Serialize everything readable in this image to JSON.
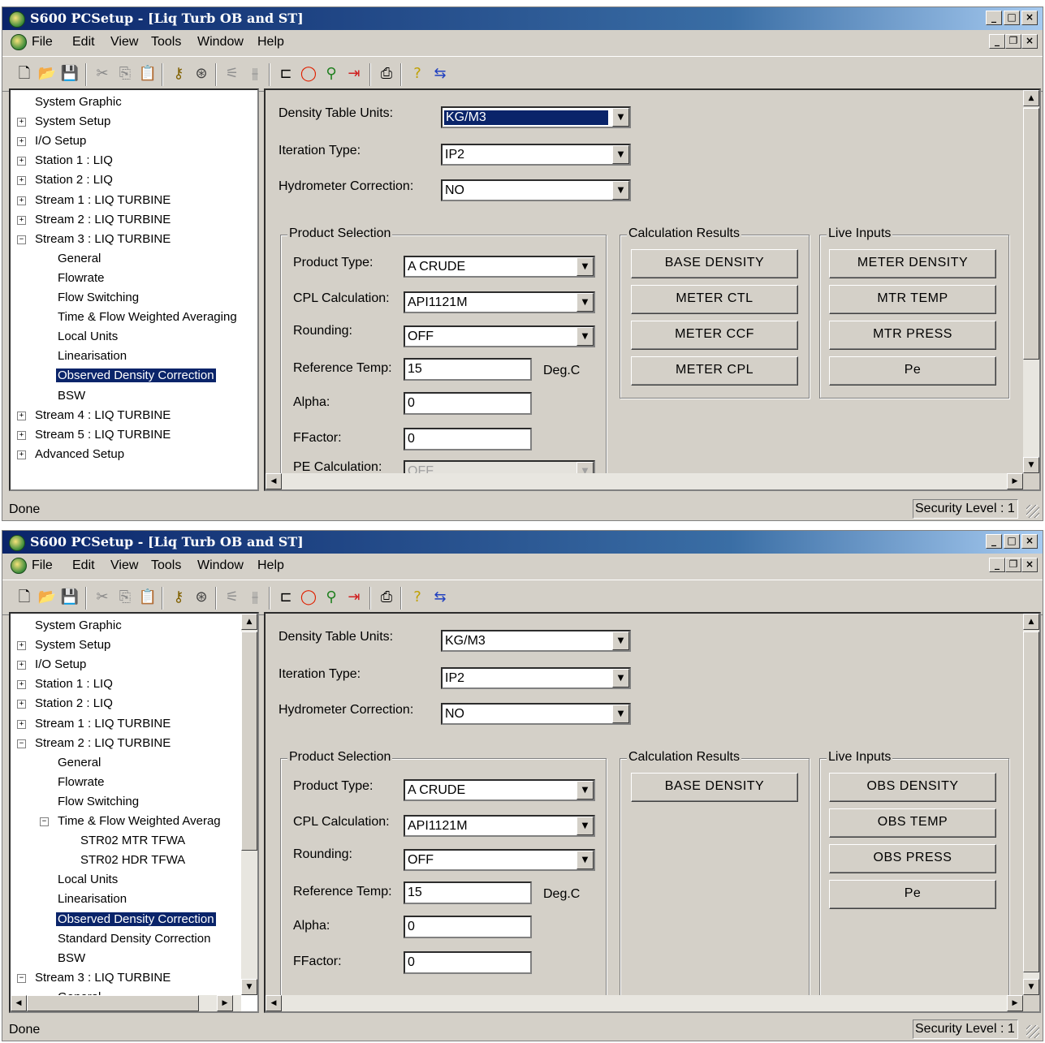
{
  "windows": [
    {
      "title": "S600 PCSetup - [Liq Turb OB and ST]",
      "menu": [
        "File",
        "Edit",
        "View",
        "Tools",
        "Window",
        "Help"
      ],
      "tree": [
        {
          "label": "System Graphic",
          "level": 0,
          "expander": "none"
        },
        {
          "label": "System Setup",
          "level": 0,
          "expander": "plus"
        },
        {
          "label": "I/O Setup",
          "level": 0,
          "expander": "plus"
        },
        {
          "label": "Station 1 : LIQ",
          "level": 0,
          "expander": "plus"
        },
        {
          "label": "Station 2 : LIQ",
          "level": 0,
          "expander": "plus"
        },
        {
          "label": "Stream 1 : LIQ TURBINE",
          "level": 0,
          "expander": "plus"
        },
        {
          "label": "Stream 2 : LIQ TURBINE",
          "level": 0,
          "expander": "plus"
        },
        {
          "label": "Stream 3 : LIQ TURBINE",
          "level": 0,
          "expander": "minus"
        },
        {
          "label": "General",
          "level": 1,
          "expander": "none"
        },
        {
          "label": "Flowrate",
          "level": 1,
          "expander": "none"
        },
        {
          "label": "Flow Switching",
          "level": 1,
          "expander": "none"
        },
        {
          "label": "Time & Flow Weighted Averaging",
          "level": 1,
          "expander": "none"
        },
        {
          "label": "Local Units",
          "level": 1,
          "expander": "none"
        },
        {
          "label": "Linearisation",
          "level": 1,
          "expander": "none"
        },
        {
          "label": "Observed Density Correction",
          "level": 1,
          "expander": "none",
          "selected": true
        },
        {
          "label": "BSW",
          "level": 1,
          "expander": "none"
        },
        {
          "label": "Stream 4 : LIQ TURBINE",
          "level": 0,
          "expander": "plus"
        },
        {
          "label": "Stream 5 : LIQ TURBINE",
          "level": 0,
          "expander": "plus"
        },
        {
          "label": "Advanced Setup",
          "level": 0,
          "expander": "plus"
        }
      ],
      "form": {
        "density_table_units_label": "Density Table Units:",
        "density_table_units_value": "KG/M3",
        "iteration_type_label": "Iteration Type:",
        "iteration_type_value": "IP2",
        "hydrometer_label": "Hydrometer Correction:",
        "hydrometer_value": "NO",
        "product_selection_label": "Product Selection",
        "product_type_label": "Product Type:",
        "product_type_value": "A CRUDE",
        "cpl_label": "CPL Calculation:",
        "cpl_value": "API1121M",
        "rounding_label": "Rounding:",
        "rounding_value": "OFF",
        "ref_temp_label": "Reference Temp:",
        "ref_temp_value": "15",
        "ref_temp_unit": "Deg.C",
        "alpha_label": "Alpha:",
        "alpha_value": "0",
        "ffactor_label": "FFactor:",
        "ffactor_value": "0",
        "pe_label": "PE Calculation:",
        "pe_value": "OFF",
        "calc_results_label": "Calculation Results",
        "calc_buttons": [
          "BASE DENSITY",
          "METER CTL",
          "METER CCF",
          "METER CPL"
        ],
        "live_inputs_label": "Live Inputs",
        "live_buttons": [
          "METER DENSITY",
          "MTR TEMP",
          "MTR PRESS",
          "Pe"
        ]
      },
      "status": {
        "left": "Done",
        "right": "Security Level : 1"
      }
    },
    {
      "title": "S600 PCSetup - [Liq Turb OB and ST]",
      "menu": [
        "File",
        "Edit",
        "View",
        "Tools",
        "Window",
        "Help"
      ],
      "tree": [
        {
          "label": "System Graphic",
          "level": 0,
          "expander": "none"
        },
        {
          "label": "System Setup",
          "level": 0,
          "expander": "plus"
        },
        {
          "label": "I/O Setup",
          "level": 0,
          "expander": "plus"
        },
        {
          "label": "Station 1 : LIQ",
          "level": 0,
          "expander": "plus"
        },
        {
          "label": "Station 2 : LIQ",
          "level": 0,
          "expander": "plus"
        },
        {
          "label": "Stream 1 : LIQ TURBINE",
          "level": 0,
          "expander": "plus"
        },
        {
          "label": "Stream 2 : LIQ TURBINE",
          "level": 0,
          "expander": "minus"
        },
        {
          "label": "General",
          "level": 1,
          "expander": "none"
        },
        {
          "label": "Flowrate",
          "level": 1,
          "expander": "none"
        },
        {
          "label": "Flow Switching",
          "level": 1,
          "expander": "none"
        },
        {
          "label": "Time & Flow Weighted Averag",
          "level": 1,
          "expander": "minus"
        },
        {
          "label": "STR02 MTR TFWA",
          "level": 2,
          "expander": "none"
        },
        {
          "label": "STR02 HDR TFWA",
          "level": 2,
          "expander": "none"
        },
        {
          "label": "Local Units",
          "level": 1,
          "expander": "none"
        },
        {
          "label": "Linearisation",
          "level": 1,
          "expander": "none"
        },
        {
          "label": "Observed Density Correction",
          "level": 1,
          "expander": "none",
          "selected": true
        },
        {
          "label": "Standard Density Correction",
          "level": 1,
          "expander": "none"
        },
        {
          "label": "BSW",
          "level": 1,
          "expander": "none"
        },
        {
          "label": "Stream 3 : LIQ TURBINE",
          "level": 0,
          "expander": "minus"
        },
        {
          "label": "General",
          "level": 1,
          "expander": "none"
        }
      ],
      "form": {
        "density_table_units_label": "Density Table Units:",
        "density_table_units_value": "KG/M3",
        "iteration_type_label": "Iteration Type:",
        "iteration_type_value": "IP2",
        "hydrometer_label": "Hydrometer Correction:",
        "hydrometer_value": "NO",
        "product_selection_label": "Product Selection",
        "product_type_label": "Product Type:",
        "product_type_value": "A CRUDE",
        "cpl_label": "CPL Calculation:",
        "cpl_value": "API1121M",
        "rounding_label": "Rounding:",
        "rounding_value": "OFF",
        "ref_temp_label": "Reference Temp:",
        "ref_temp_value": "15",
        "ref_temp_unit": "Deg.C",
        "alpha_label": "Alpha:",
        "alpha_value": "0",
        "ffactor_label": "FFactor:",
        "ffactor_value": "0",
        "calc_results_label": "Calculation Results",
        "calc_buttons": [
          "BASE DENSITY"
        ],
        "live_inputs_label": "Live Inputs",
        "live_buttons": [
          "OBS DENSITY",
          "OBS TEMP",
          "OBS PRESS",
          "Pe"
        ]
      },
      "status": {
        "left": "Done",
        "right": "Security Level : 1"
      }
    }
  ],
  "toolbar_icons": [
    "new-icon",
    "open-icon",
    "save-icon",
    "cut-icon",
    "copy-icon",
    "paste-icon",
    "key-icon",
    "connect-icon",
    "tool-icon",
    "tool2-icon",
    "module-icon",
    "stop-icon",
    "pin-icon",
    "arrow-icon",
    "print-icon",
    "help-icon",
    "transfer-icon"
  ]
}
